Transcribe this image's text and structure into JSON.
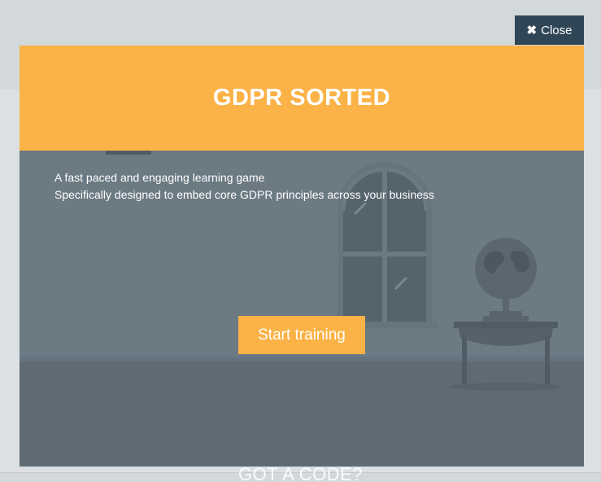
{
  "close_button": {
    "icon": "close-icon",
    "label": "Close"
  },
  "modal": {
    "title": "GDPR SORTED",
    "description_lines": [
      "A fast paced and engaging learning game",
      "Specifically designed to embed core GDPR principles across your business"
    ],
    "start_button_label": "Start training"
  },
  "background": {
    "code_prompt": "GOT A CODE?"
  },
  "colors": {
    "accent": "#fbb246",
    "close_button_bg": "#2f4657",
    "modal_body_bg": "#6a7882",
    "page_bg": "#d3d8db"
  }
}
